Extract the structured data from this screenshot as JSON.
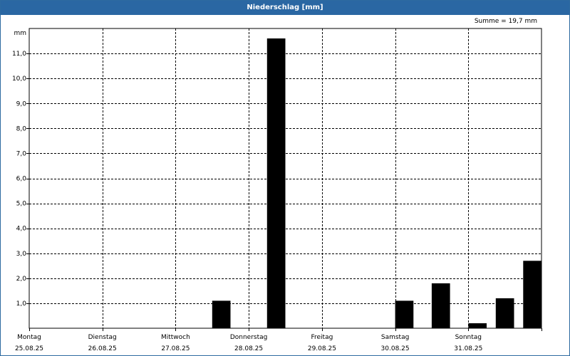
{
  "window": {
    "title": "Niederschlag [mm]"
  },
  "summary": {
    "text": "Summe = 19,7 mm"
  },
  "chart_data": {
    "type": "bar",
    "title": "Niederschlag [mm]",
    "ylabel": "mm",
    "ylim": [
      0,
      12
    ],
    "y_ticks": [
      "1,0",
      "2,0",
      "3,0",
      "4,0",
      "5,0",
      "6,0",
      "7,0",
      "8,0",
      "9,0",
      "10,0",
      "11,0"
    ],
    "y_tick_values": [
      1,
      2,
      3,
      4,
      5,
      6,
      7,
      8,
      9,
      10,
      11
    ],
    "x_range_days": [
      0,
      7
    ],
    "days": [
      {
        "name": "Montag",
        "date": "25.08.25"
      },
      {
        "name": "Dienstag",
        "date": "26.08.25"
      },
      {
        "name": "Mittwoch",
        "date": "27.08.25"
      },
      {
        "name": "Donnerstag",
        "date": "28.08.25"
      },
      {
        "name": "Freitag",
        "date": "29.08.25"
      },
      {
        "name": "Samstag",
        "date": "30.08.25"
      },
      {
        "name": "Sonntag",
        "date": "31.08.25"
      }
    ],
    "bars": [
      {
        "start": "27.08.25 12:00",
        "end": "27.08.25 18:00",
        "value": 1.1
      },
      {
        "start": "28.08.25 06:00",
        "end": "28.08.25 12:00",
        "value": 11.6
      },
      {
        "start": "30.08.25 00:00",
        "end": "30.08.25 06:00",
        "value": 1.1
      },
      {
        "start": "30.08.25 12:00",
        "end": "30.08.25 18:00",
        "value": 1.8
      },
      {
        "start": "31.08.25 00:00",
        "end": "31.08.25 06:00",
        "value": 0.2
      },
      {
        "start": "31.08.25 09:00",
        "end": "31.08.25 15:00",
        "value": 1.2
      },
      {
        "start": "31.08.25 18:00",
        "end": "01.09.25 00:00",
        "value": 2.7
      }
    ],
    "grid": true,
    "colors": {
      "bar": "#000000",
      "titlebar": "#2a67a3"
    }
  }
}
